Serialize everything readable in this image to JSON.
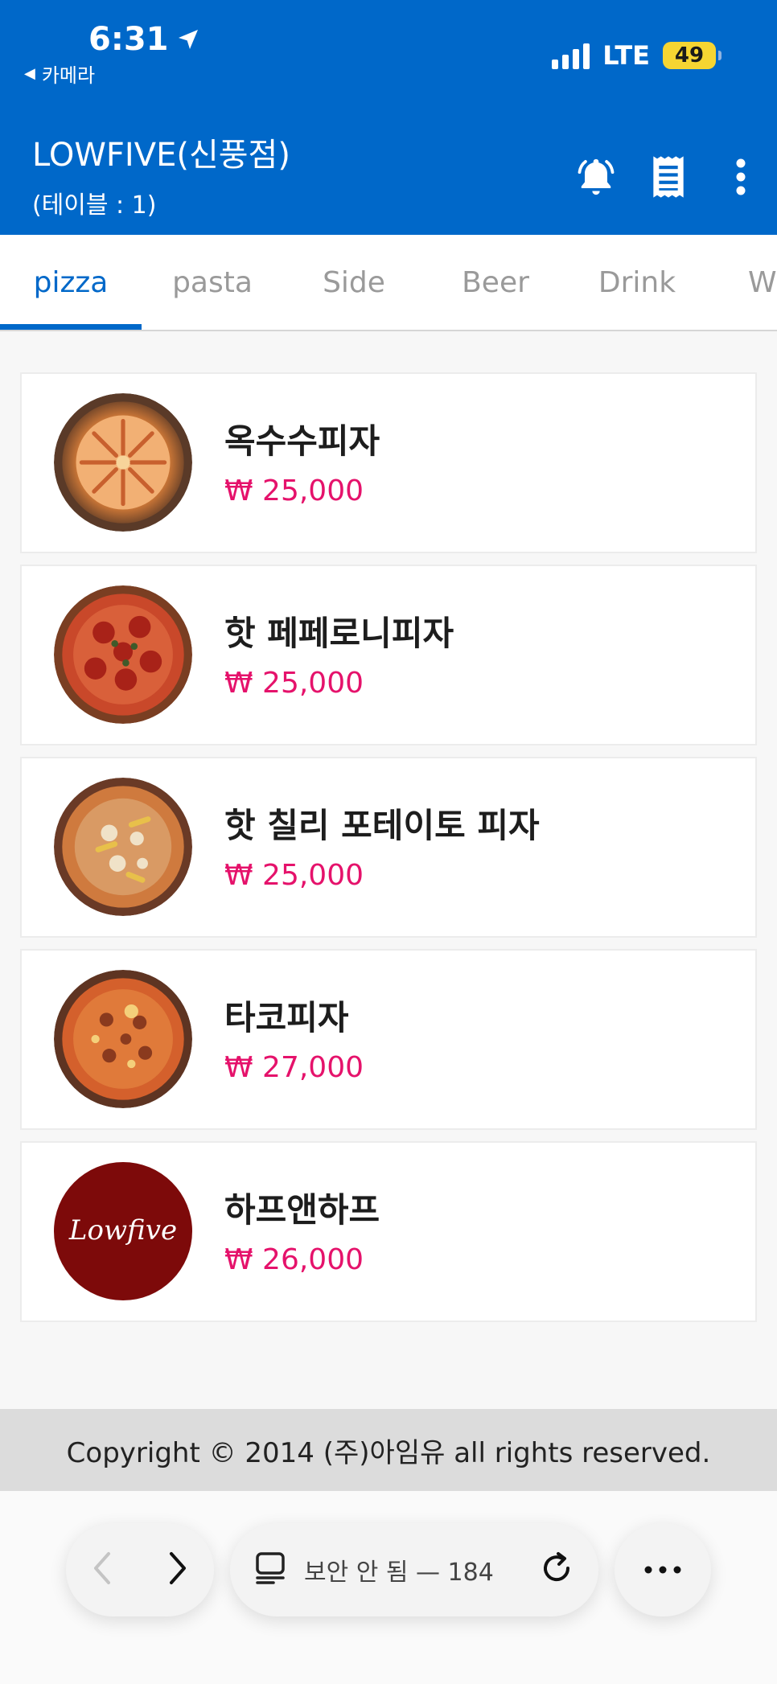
{
  "status_bar": {
    "time": "6:31",
    "back_app": "카메라",
    "network": "LTE",
    "battery": "49"
  },
  "header": {
    "store_name": "LOWFIVE(신풍점)",
    "table_info": "(테이블 : 1)",
    "icons": [
      "bell-icon",
      "receipt-icon",
      "more-vertical-icon"
    ]
  },
  "tabs": [
    {
      "label": "pizza",
      "active": true
    },
    {
      "label": "pasta",
      "active": false
    },
    {
      "label": "Side",
      "active": false
    },
    {
      "label": "Beer",
      "active": false
    },
    {
      "label": "Drink",
      "active": false
    },
    {
      "label": "W",
      "active": false
    }
  ],
  "menu_items": [
    {
      "name": "옥수수피자",
      "price": "₩ 25,000"
    },
    {
      "name": "핫 페페로니피자",
      "price": "₩ 25,000"
    },
    {
      "name": "핫 칠리 포테이토 피자",
      "price": "₩ 25,000"
    },
    {
      "name": "타코피자",
      "price": "₩ 27,000"
    },
    {
      "name": "하프앤하프",
      "price": "₩ 26,000",
      "thumb_text": "Lowfive"
    }
  ],
  "footer": {
    "copyright": "Copyright © 2014 (주)아임유 all rights reserved."
  },
  "browser_bar": {
    "url_text": "보안 안 됨 — 184"
  },
  "colors": {
    "primary": "#0068c9",
    "price": "#e5126b",
    "logo_bg": "#7d0a0a"
  }
}
